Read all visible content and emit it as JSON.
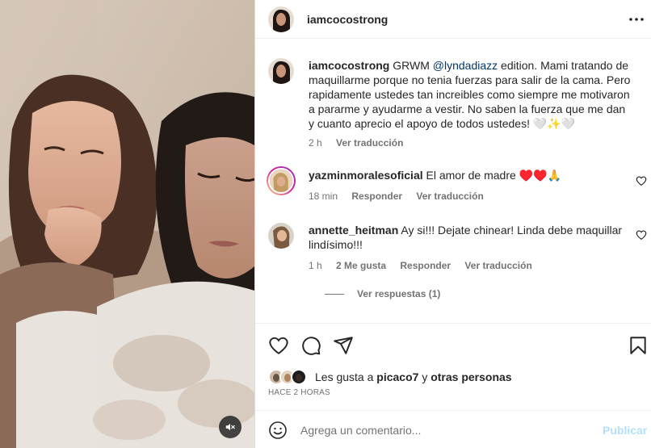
{
  "post": {
    "username": "iamcocostrong",
    "caption": {
      "username": "iamcocostrong",
      "prefix": "GRWM",
      "mention": "@lyndadiazz",
      "text": "edition. Mami tratando de maquillarme porque no tenia fuerzas para salir de la cama. Pero rapidamente ustedes tan increibles como siempre me motivaron a pararme y ayudarme a vestir. No saben la fuerza que me dan y cuanto aprecio el apoyo de todos ustedes! 🤍✨🤍",
      "time": "2 h",
      "translate": "Ver traducción"
    },
    "comments": [
      {
        "username": "yazminmoralesoficial",
        "text": "El amor de madre ♥️♥️🙏",
        "time": "18 min",
        "reply": "Responder",
        "translate": "Ver traducción"
      },
      {
        "username": "annette_heitman",
        "text": "Ay si!!! Dejate chinear! Linda debe maquillar lindísimo!!!",
        "time": "1 h",
        "likes": "2 Me gusta",
        "reply": "Responder",
        "translate": "Ver traducción",
        "view_replies": "Ver respuestas (1)"
      }
    ],
    "likes": {
      "prefix": "Les gusta a",
      "user": "picaco7",
      "joiner": "y",
      "others": "otras personas"
    },
    "posted_ago": "HACE 2 HORAS",
    "add_comment": {
      "placeholder": "Agrega un comentario...",
      "publish": "Publicar"
    }
  },
  "icons": {
    "more": "more-horizontal-icon",
    "mute": "speaker-muted-icon",
    "like": "heart-icon",
    "comment": "comment-bubble-icon",
    "share": "paper-plane-icon",
    "save": "bookmark-icon",
    "emoji": "smiley-icon"
  },
  "colors": {
    "link": "#00376b",
    "muted_text": "#737373",
    "publish_disabled": "#b2dffc",
    "story_ring": "#d6249f"
  }
}
